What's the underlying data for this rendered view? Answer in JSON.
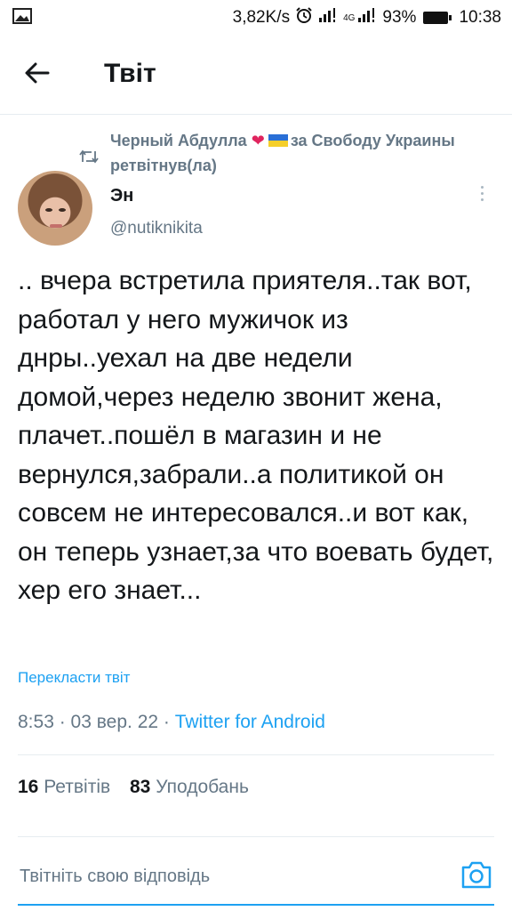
{
  "status_bar": {
    "network_speed": "3,82K/s",
    "network_type": "4G",
    "battery": "93%",
    "time": "10:38"
  },
  "header": {
    "title": "Твіт"
  },
  "tweet": {
    "retweeted_by": {
      "name": "Черный Абдулла",
      "heart": "❤",
      "suffix": "за Свободу Украины",
      "label": "ретвітнув(ла)"
    },
    "author": {
      "name": "Эн",
      "handle": "@nutiknikita"
    },
    "text": "..  вчера встретила приятеля..так вот, работал у него мужичок из днры..уехал на две недели домой,через неделю звонит жена, плачет..пошёл в магазин и не вернулся,забрали..а политикой он совсем не интересовался..и вот как, он теперь узнает,за что воевать будет, хер его знает...",
    "translate_label": "Перекласти твіт",
    "time": "8:53",
    "date": "03 вер. 22",
    "source": "Twitter for Android",
    "retweets_count": "16",
    "retweets_label": "Ретвітів",
    "likes_count": "83",
    "likes_label": "Уподобань"
  },
  "reply": {
    "placeholder": "Твітніть свою відповідь"
  },
  "colors": {
    "accent": "#1da1f2",
    "secondary_text": "#657786",
    "divider": "#e6ecf0",
    "heart": "#e0245e"
  },
  "icons": [
    "image-icon",
    "alarm-icon",
    "signal-icon",
    "battery-icon",
    "back-arrow-icon",
    "retweet-icon",
    "more-vertical-icon",
    "camera-icon"
  ]
}
